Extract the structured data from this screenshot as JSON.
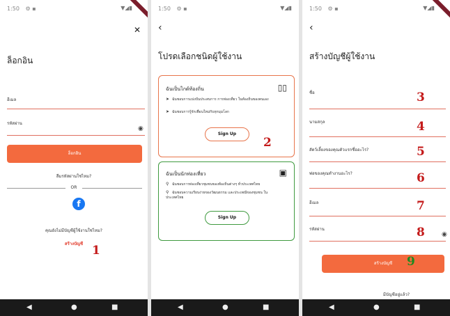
{
  "status": {
    "time": "1:50"
  },
  "navbar": {
    "back_icon": "◀",
    "home_icon": "●",
    "recents_icon": "■"
  },
  "screen1": {
    "title": "ล็อกอิน",
    "email_label": "อีเมล",
    "password_label": "รหัสผ่าน",
    "login_button": "ล็อกอิน",
    "forgot_password": "ลืมรหัสผ่านใช่ไหม?",
    "or_text": "OR",
    "no_account": "คุณยังไม่มีบัญชีผู้ใช้งานใช่ไหม?",
    "create_account_link": "สร้างบัญชี",
    "annotation": "1"
  },
  "screen2": {
    "title": "โปรดเลือกชนิดผู้ใช้งาน",
    "guide_card": {
      "title": "ฉันเป็นไกด์ท้องถิ่น",
      "bullet1": "ฉันชอบการแบ่งปันประสบการ การท่องเที่ยว ในท้องถิ่นของตนเอง",
      "bullet2": "ฉันชอบการรู้จักเพื่อนใหม่กับทุกมุมโลก",
      "button": "Sign Up",
      "annotation": "2"
    },
    "tourist_card": {
      "title": "ฉันเป็นนักท่องเที่ยว",
      "bullet1": "ฉันชอบการท่องเที่ยวชุมชนของท้องถิ่นต่างๆ ทั่วประเทศไทย",
      "bullet2": "ฉันชอบความเรียบง่ายของวัฒนธรรม และประเพณีของชุมชน ในประเทศไทย",
      "button": "Sign Up"
    }
  },
  "screen3": {
    "title": "สร้างบัญชีผู้ใช้งาน",
    "fields": [
      {
        "label": "ชื่อ",
        "annotation": "3"
      },
      {
        "label": "นามสกุล",
        "annotation": "4"
      },
      {
        "label": "สัตว์เลี้ยงของคุณตัวแรกชื่ออะไร?",
        "annotation": "5"
      },
      {
        "label": "พ่อของคุณทำงานอะไร?",
        "annotation": "6"
      },
      {
        "label": "อีเมล",
        "annotation": "7"
      },
      {
        "label": "รหัสผ่าน",
        "annotation": "8"
      }
    ],
    "submit_button": "สร้างบัญชี",
    "submit_annotation": "9",
    "have_account": "มีบัญชีอยู่แล้ว?"
  }
}
